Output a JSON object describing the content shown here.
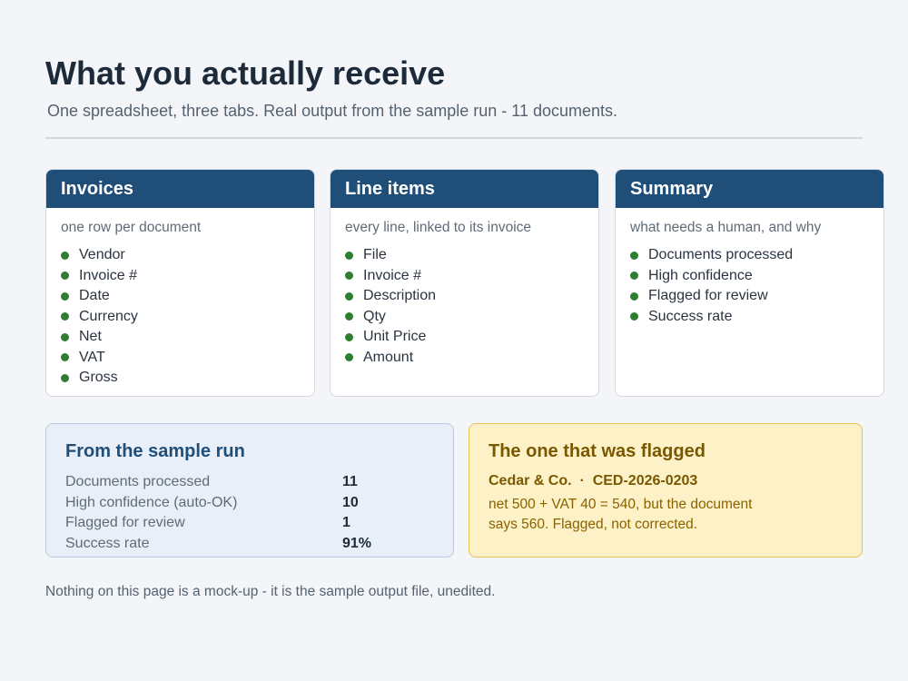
{
  "header": {
    "title": "What you actually receive",
    "subtitle": "One spreadsheet, three tabs. Real output from the sample run - 11 documents."
  },
  "tabs": [
    {
      "name": "Invoices",
      "description": "one row per document",
      "fields": [
        "Vendor",
        "Invoice #",
        "Date",
        "Currency",
        "Net",
        "VAT",
        "Gross"
      ]
    },
    {
      "name": "Line items",
      "description": "every line, linked to its invoice",
      "fields": [
        "File",
        "Invoice #",
        "Description",
        "Qty",
        "Unit Price",
        "Amount"
      ]
    },
    {
      "name": "Summary",
      "description": "what needs a human, and why",
      "fields": [
        "Documents processed",
        "High confidence",
        "Flagged for review",
        "Success rate"
      ]
    }
  ],
  "sample_run": {
    "title": "From the sample run",
    "rows": [
      {
        "label": "Documents processed",
        "value": "11"
      },
      {
        "label": "High confidence (auto-OK)",
        "value": "10"
      },
      {
        "label": "Flagged for review",
        "value": "1"
      },
      {
        "label": "Success rate",
        "value": "91%"
      }
    ]
  },
  "flagged": {
    "title": "The one that was flagged",
    "vendor": "Cedar & Co.",
    "separator": "·",
    "invoice": "CED-2026-0203",
    "note": "net 500 + VAT 40 = 540, but the document says 560. Flagged, not corrected."
  },
  "footer": "Nothing on this page is a mock-up - it is the sample output file, unedited.",
  "colors": {
    "header_bar": "#1f4e79",
    "bullet": "#2e7d32",
    "stats_bg": "#e8eff8",
    "flag_bg": "#fdf1c7",
    "flag_text": "#8a6200"
  }
}
